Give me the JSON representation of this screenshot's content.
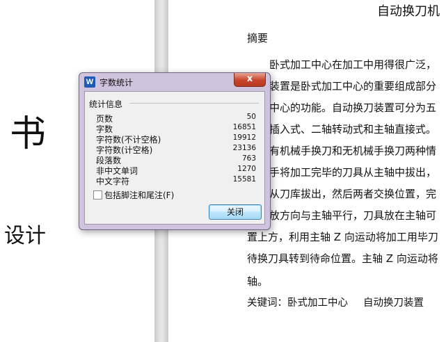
{
  "left_page": {
    "big_char": "书",
    "design_text": "设计"
  },
  "right_page": {
    "title": "自动换刀机",
    "abstract_label": "摘要",
    "lines": [
      "卧式加工中心在加工中用得很广泛，",
      "装置是卧式加工中心的重要组成部分",
      "中心的功能。自动换刀装置可分为五",
      "插入式、二轴转动式和主轴直接式。",
      "有机械手换刀和无机械手换刀两种情",
      "手将加工完毕的刀具从主轴中拔出，",
      "从刀库拔出，然后两者交换位置，完",
      "放方向与主轴平行，刀具放在主轴可",
      "置上方，利用主轴 Z 向运动将加工用毕刀",
      "待换刀具转到待命位置。主轴 Z 向运动将",
      "轴。"
    ],
    "keywords_label": "关键词：卧式加工中心",
    "keywords_2": "自动换刀装置"
  },
  "dialog": {
    "title": "字数统计",
    "app_icon": "W",
    "close_label": "x",
    "group_label": "统计信息",
    "stats": [
      {
        "label": "页数",
        "value": "50"
      },
      {
        "label": "字数",
        "value": "16851"
      },
      {
        "label": "字符数(不计空格)",
        "value": "19912"
      },
      {
        "label": "字符数(计空格)",
        "value": "23136"
      },
      {
        "label": "段落数",
        "value": "763"
      },
      {
        "label": "非中文单词",
        "value": "1270"
      },
      {
        "label": "中文字符",
        "value": "15581"
      }
    ],
    "checkbox_label": "包括脚注和尾注(F)",
    "checkbox_checked": false,
    "ok_label": "关闭",
    "accent_color": "#c7442a"
  }
}
